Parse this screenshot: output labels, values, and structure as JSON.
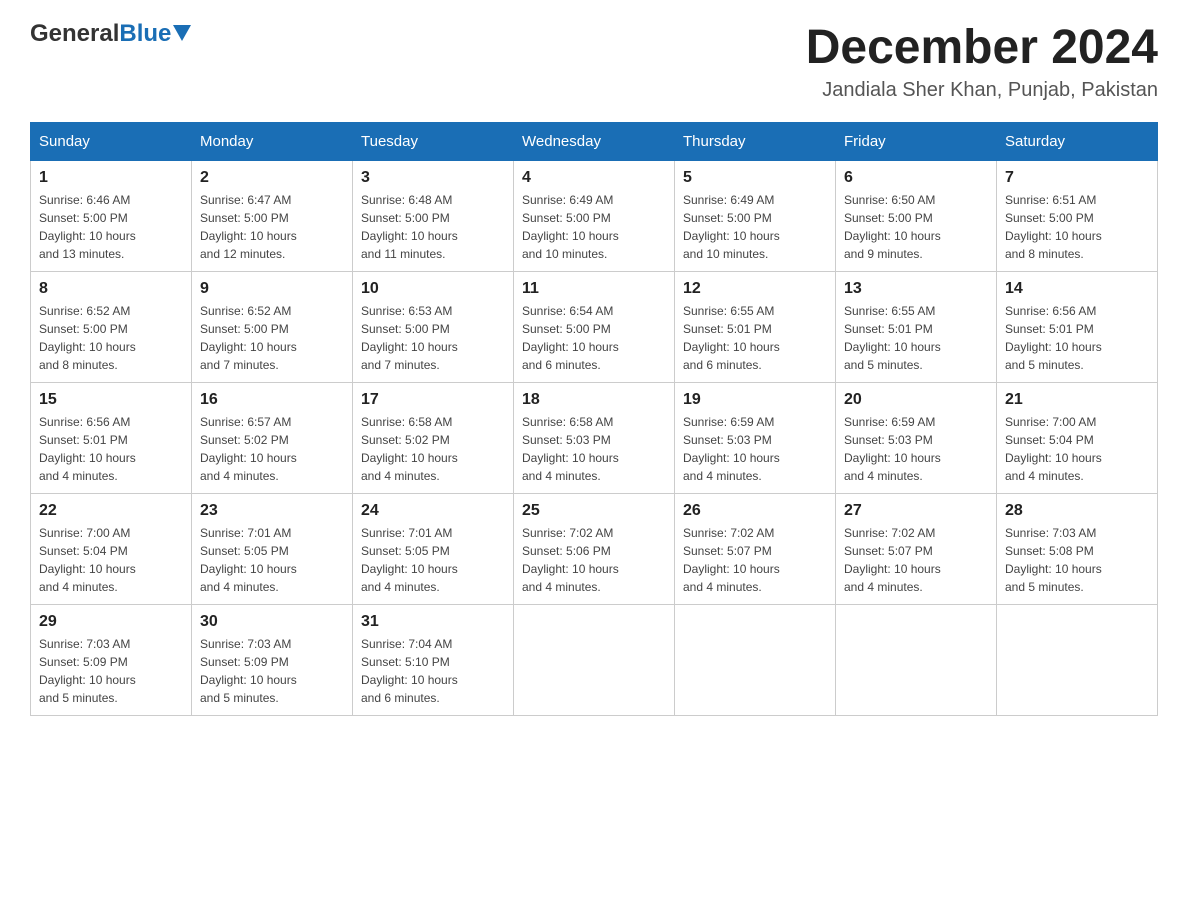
{
  "header": {
    "logo_general": "General",
    "logo_blue": "Blue",
    "month_title": "December 2024",
    "location": "Jandiala Sher Khan, Punjab, Pakistan"
  },
  "weekdays": [
    "Sunday",
    "Monday",
    "Tuesday",
    "Wednesday",
    "Thursday",
    "Friday",
    "Saturday"
  ],
  "weeks": [
    [
      {
        "day": "1",
        "sunrise": "6:46 AM",
        "sunset": "5:00 PM",
        "daylight": "10 hours and 13 minutes."
      },
      {
        "day": "2",
        "sunrise": "6:47 AM",
        "sunset": "5:00 PM",
        "daylight": "10 hours and 12 minutes."
      },
      {
        "day": "3",
        "sunrise": "6:48 AM",
        "sunset": "5:00 PM",
        "daylight": "10 hours and 11 minutes."
      },
      {
        "day": "4",
        "sunrise": "6:49 AM",
        "sunset": "5:00 PM",
        "daylight": "10 hours and 10 minutes."
      },
      {
        "day": "5",
        "sunrise": "6:49 AM",
        "sunset": "5:00 PM",
        "daylight": "10 hours and 10 minutes."
      },
      {
        "day": "6",
        "sunrise": "6:50 AM",
        "sunset": "5:00 PM",
        "daylight": "10 hours and 9 minutes."
      },
      {
        "day": "7",
        "sunrise": "6:51 AM",
        "sunset": "5:00 PM",
        "daylight": "10 hours and 8 minutes."
      }
    ],
    [
      {
        "day": "8",
        "sunrise": "6:52 AM",
        "sunset": "5:00 PM",
        "daylight": "10 hours and 8 minutes."
      },
      {
        "day": "9",
        "sunrise": "6:52 AM",
        "sunset": "5:00 PM",
        "daylight": "10 hours and 7 minutes."
      },
      {
        "day": "10",
        "sunrise": "6:53 AM",
        "sunset": "5:00 PM",
        "daylight": "10 hours and 7 minutes."
      },
      {
        "day": "11",
        "sunrise": "6:54 AM",
        "sunset": "5:00 PM",
        "daylight": "10 hours and 6 minutes."
      },
      {
        "day": "12",
        "sunrise": "6:55 AM",
        "sunset": "5:01 PM",
        "daylight": "10 hours and 6 minutes."
      },
      {
        "day": "13",
        "sunrise": "6:55 AM",
        "sunset": "5:01 PM",
        "daylight": "10 hours and 5 minutes."
      },
      {
        "day": "14",
        "sunrise": "6:56 AM",
        "sunset": "5:01 PM",
        "daylight": "10 hours and 5 minutes."
      }
    ],
    [
      {
        "day": "15",
        "sunrise": "6:56 AM",
        "sunset": "5:01 PM",
        "daylight": "10 hours and 4 minutes."
      },
      {
        "day": "16",
        "sunrise": "6:57 AM",
        "sunset": "5:02 PM",
        "daylight": "10 hours and 4 minutes."
      },
      {
        "day": "17",
        "sunrise": "6:58 AM",
        "sunset": "5:02 PM",
        "daylight": "10 hours and 4 minutes."
      },
      {
        "day": "18",
        "sunrise": "6:58 AM",
        "sunset": "5:03 PM",
        "daylight": "10 hours and 4 minutes."
      },
      {
        "day": "19",
        "sunrise": "6:59 AM",
        "sunset": "5:03 PM",
        "daylight": "10 hours and 4 minutes."
      },
      {
        "day": "20",
        "sunrise": "6:59 AM",
        "sunset": "5:03 PM",
        "daylight": "10 hours and 4 minutes."
      },
      {
        "day": "21",
        "sunrise": "7:00 AM",
        "sunset": "5:04 PM",
        "daylight": "10 hours and 4 minutes."
      }
    ],
    [
      {
        "day": "22",
        "sunrise": "7:00 AM",
        "sunset": "5:04 PM",
        "daylight": "10 hours and 4 minutes."
      },
      {
        "day": "23",
        "sunrise": "7:01 AM",
        "sunset": "5:05 PM",
        "daylight": "10 hours and 4 minutes."
      },
      {
        "day": "24",
        "sunrise": "7:01 AM",
        "sunset": "5:05 PM",
        "daylight": "10 hours and 4 minutes."
      },
      {
        "day": "25",
        "sunrise": "7:02 AM",
        "sunset": "5:06 PM",
        "daylight": "10 hours and 4 minutes."
      },
      {
        "day": "26",
        "sunrise": "7:02 AM",
        "sunset": "5:07 PM",
        "daylight": "10 hours and 4 minutes."
      },
      {
        "day": "27",
        "sunrise": "7:02 AM",
        "sunset": "5:07 PM",
        "daylight": "10 hours and 4 minutes."
      },
      {
        "day": "28",
        "sunrise": "7:03 AM",
        "sunset": "5:08 PM",
        "daylight": "10 hours and 5 minutes."
      }
    ],
    [
      {
        "day": "29",
        "sunrise": "7:03 AM",
        "sunset": "5:09 PM",
        "daylight": "10 hours and 5 minutes."
      },
      {
        "day": "30",
        "sunrise": "7:03 AM",
        "sunset": "5:09 PM",
        "daylight": "10 hours and 5 minutes."
      },
      {
        "day": "31",
        "sunrise": "7:04 AM",
        "sunset": "5:10 PM",
        "daylight": "10 hours and 6 minutes."
      },
      null,
      null,
      null,
      null
    ]
  ],
  "labels": {
    "sunrise": "Sunrise:",
    "sunset": "Sunset:",
    "daylight": "Daylight:"
  }
}
